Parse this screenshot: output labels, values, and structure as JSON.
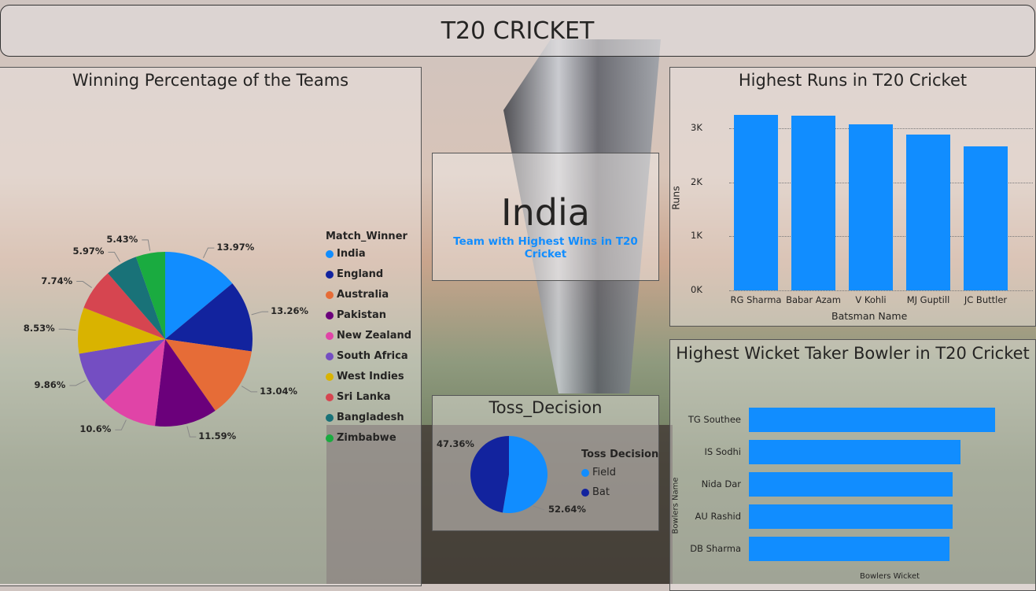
{
  "header": {
    "title": "T20 CRICKET"
  },
  "card": {
    "value": "India",
    "label": "Team with Highest Wins in T20 Cricket"
  },
  "colors": {
    "accent": "#118dff",
    "dark_blue": "#12239e"
  },
  "chart_data": [
    {
      "type": "pie",
      "title": "Winning Percentage of the Teams",
      "legend_title": "Match_Winner",
      "legend_position": "right",
      "categories": [
        "India",
        "England",
        "Australia",
        "Pakistan",
        "New Zealand",
        "South Africa",
        "West Indies",
        "Sri Lanka",
        "Bangladesh",
        "Zimbabwe"
      ],
      "values": [
        13.97,
        13.26,
        13.04,
        11.59,
        10.6,
        9.86,
        8.53,
        7.74,
        5.97,
        5.43
      ],
      "labels": [
        "13.97%",
        "13.26%",
        "13.04%",
        "11.59%",
        "10.6%",
        "9.86%",
        "8.53%",
        "7.74%",
        "5.97%",
        "5.43%"
      ],
      "colors": [
        "#118dff",
        "#12239e",
        "#e66c37",
        "#6b007b",
        "#e044a7",
        "#744ec2",
        "#d9b300",
        "#d64550",
        "#197278",
        "#1aab40"
      ]
    },
    {
      "type": "pie",
      "title": "Toss_Decision",
      "legend_title": "Toss Decision",
      "legend_position": "right",
      "categories": [
        "Field",
        "Bat"
      ],
      "values": [
        52.64,
        47.36
      ],
      "labels": [
        "52.64%",
        "47.36%"
      ],
      "colors": [
        "#118dff",
        "#12239e"
      ]
    },
    {
      "type": "bar",
      "title": "Highest Runs in T20 Cricket",
      "xlabel": "Batsman Name",
      "ylabel": "Runs",
      "categories": [
        "RG Sharma",
        "Babar Azam",
        "V Kohli",
        "MJ Guptill",
        "JC Buttler"
      ],
      "values": [
        3250,
        3230,
        3070,
        2880,
        2660
      ],
      "ylim": [
        0,
        3000
      ],
      "yticks": [
        "0K",
        "1K",
        "2K",
        "3K"
      ],
      "grid": true
    },
    {
      "type": "bar",
      "orientation": "horizontal",
      "title": "Highest Wicket Taker Bowler in T20 Cricket",
      "xlabel": "Bowlers Wicket",
      "ylabel": "Bowlers Name",
      "categories": [
        "TG Southee",
        "IS Sodhi",
        "Nida Dar",
        "AU Rashid",
        "DB Sharma"
      ],
      "values": [
        134,
        115,
        111,
        111,
        109
      ]
    }
  ]
}
